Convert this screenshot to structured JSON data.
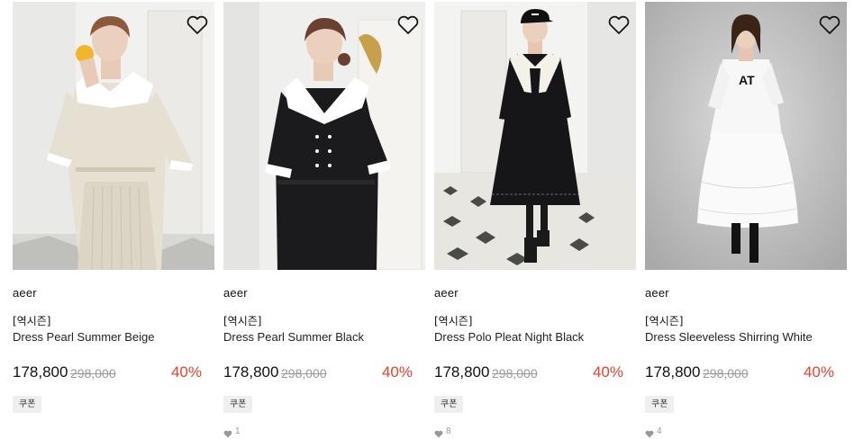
{
  "products": [
    {
      "brand": "aeer",
      "tag": "[역시즌]",
      "name": "Dress Pearl Summer Beige",
      "price": "178,800",
      "original_price": "298,000",
      "discount": "40%",
      "coupon": "쿠폰",
      "likes": "",
      "photo_icon": "product-photo-beige-dress"
    },
    {
      "brand": "aeer",
      "tag": "[역시즌]",
      "name": "Dress Pearl Summer Black",
      "price": "178,800",
      "original_price": "298,000",
      "discount": "40%",
      "coupon": "쿠폰",
      "likes": "1",
      "photo_icon": "product-photo-black-dress"
    },
    {
      "brand": "aeer",
      "tag": "[역시즌]",
      "name": "Dress Polo Pleat Night Black",
      "price": "178,800",
      "original_price": "298,000",
      "discount": "40%",
      "coupon": "쿠폰",
      "likes": "8",
      "photo_icon": "product-photo-polo-dress"
    },
    {
      "brand": "aeer",
      "tag": "[역시즌]",
      "name": "Dress Sleeveless Shirring White",
      "price": "178,800",
      "original_price": "298,000",
      "discount": "40%",
      "coupon": "쿠폰",
      "likes": "4",
      "photo_icon": "product-photo-white-dress",
      "shirt_print": "AT"
    }
  ],
  "colors": {
    "discount": "#e8412c",
    "strike_price": "#9a9a9a",
    "coupon_bg": "#efefef",
    "accent_text": "#111111"
  },
  "icons": {
    "wishlist": "heart-outline-icon",
    "likes": "heart-filled-icon"
  }
}
